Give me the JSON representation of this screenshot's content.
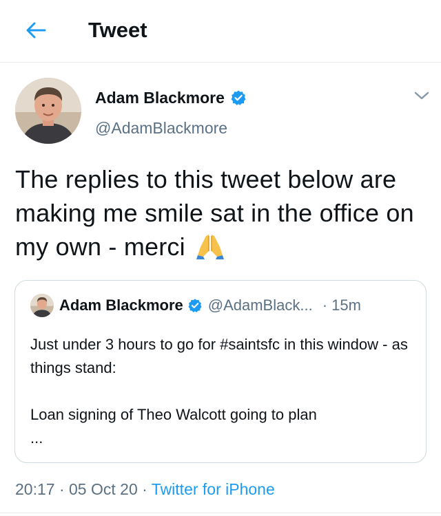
{
  "header": {
    "title": "Tweet",
    "back_icon": "arrow-left-icon"
  },
  "tweet": {
    "author_name": "Adam Blackmore",
    "author_handle": "@AdamBlackmore",
    "text": "The replies to this tweet below are making me smile sat in the office on my own - merci",
    "emoji": "folded-hands-emoji",
    "timestamp": "20:17",
    "separator": "·",
    "date": "05 Oct 20",
    "source": "Twitter for iPhone"
  },
  "quote": {
    "author_name": "Adam Blackmore",
    "author_handle": "@AdamBlack...",
    "time": "· 15m",
    "text": "Just under 3 hours to go for #saintsfc in this window - as things stand:\n\nLoan signing of Theo Walcott going to plan\n..."
  },
  "colors": {
    "accent": "#1d9bf0",
    "text": "#0f1419",
    "secondary": "#5b7083",
    "border": "#cfd9de"
  }
}
